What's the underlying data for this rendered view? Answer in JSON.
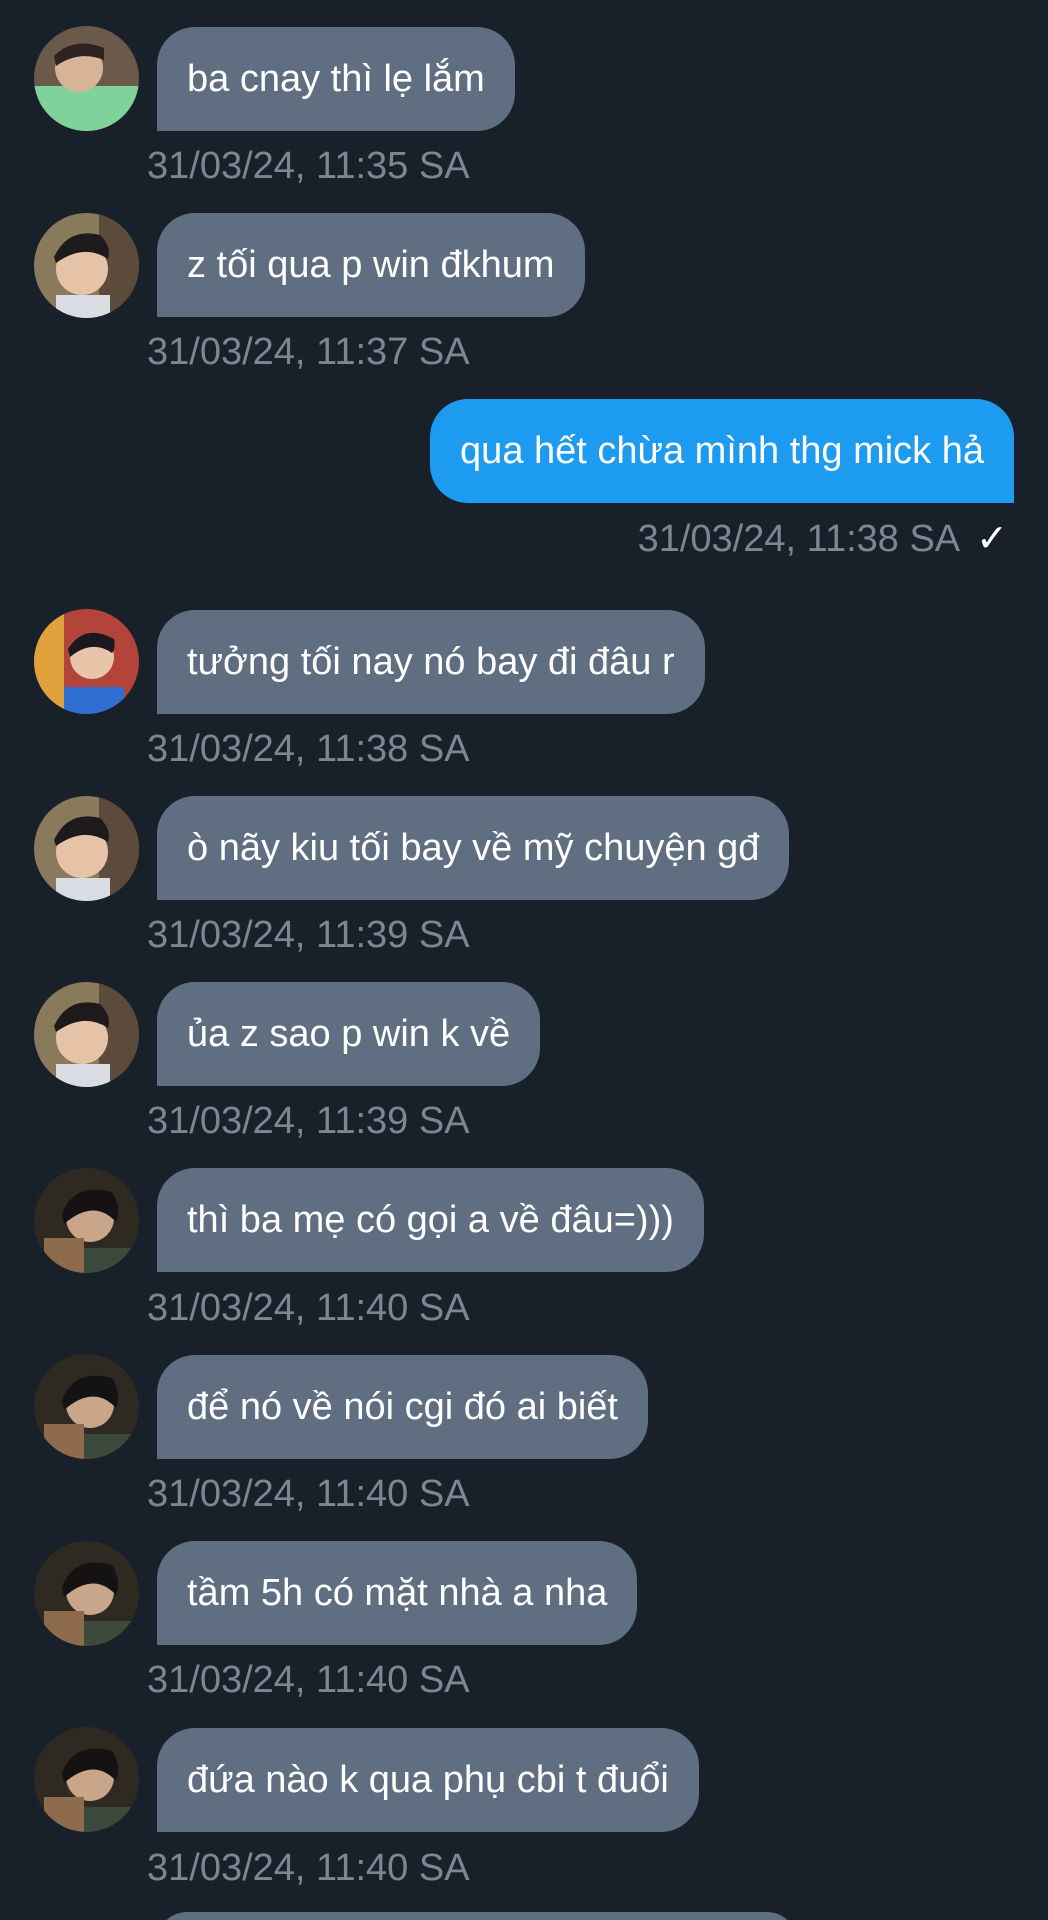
{
  "colors": {
    "background": "#18202a",
    "incoming_bubble": "#5f6e80",
    "outgoing_bubble": "#1d9bf0",
    "timestamp": "#7c8794"
  },
  "messages": [
    {
      "direction": "in",
      "avatar": "avatar-green-shirt",
      "text": "ba cnay thì lẹ lắm",
      "time": "31/03/24, 11:35 SA"
    },
    {
      "direction": "in",
      "avatar": "avatar-young-man",
      "text": "z tối qua p win đkhum",
      "time": "31/03/24, 11:37 SA"
    },
    {
      "direction": "out",
      "text": "qua hết chừa mình thg mick hả",
      "time": "31/03/24, 11:38 SA",
      "status_icon": "check-icon",
      "status_glyph": "✓"
    },
    {
      "direction": "in",
      "avatar": "avatar-blue-shirt",
      "text": "tưởng tối nay nó bay đi đâu r",
      "time": "31/03/24, 11:38 SA"
    },
    {
      "direction": "in",
      "avatar": "avatar-young-man",
      "text": "ò nãy kiu tối bay về mỹ chuyện gđ",
      "time": "31/03/24, 11:39 SA"
    },
    {
      "direction": "in",
      "avatar": "avatar-young-man",
      "text": "ủa z sao p win k về",
      "time": "31/03/24, 11:39 SA"
    },
    {
      "direction": "in",
      "avatar": "avatar-dark-hair",
      "text": "thì ba mẹ có gọi a về đâu=)))",
      "time": "31/03/24, 11:40 SA"
    },
    {
      "direction": "in",
      "avatar": "avatar-dark-hair",
      "text": "để nó về nói cgi đó ai biết",
      "time": "31/03/24, 11:40 SA"
    },
    {
      "direction": "in",
      "avatar": "avatar-dark-hair",
      "text": "tầm 5h có mặt nhà a nha",
      "time": "31/03/24, 11:40 SA"
    },
    {
      "direction": "in",
      "avatar": "avatar-dark-hair",
      "text": "đứa nào k qua phụ cbi t đuổi",
      "time": "31/03/24, 11:40 SA"
    }
  ]
}
